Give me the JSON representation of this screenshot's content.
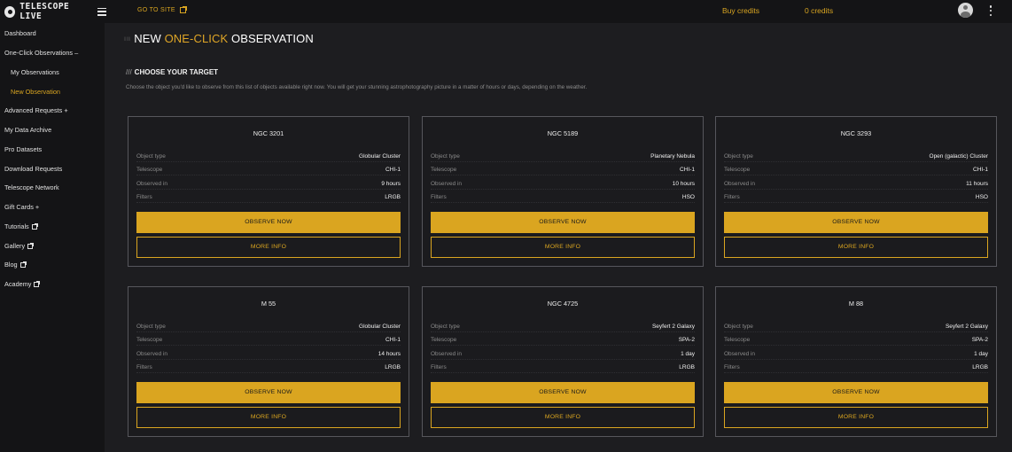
{
  "brand": {
    "name": "TELESCOPE LIVE"
  },
  "header": {
    "go_to_site": "GO TO SITE",
    "buy_credits": "Buy credits",
    "credits": "0 credits"
  },
  "sidebar": {
    "items": [
      {
        "label": "Dashboard"
      },
      {
        "label": "One-Click Observations –"
      },
      {
        "label": "My Observations"
      },
      {
        "label": "New Observation"
      },
      {
        "label": "Advanced Requests +"
      },
      {
        "label": "My Data Archive"
      },
      {
        "label": "Pro Datasets"
      },
      {
        "label": "Download Requests"
      },
      {
        "label": "Telescope Network"
      },
      {
        "label": "Gift Cards +"
      },
      {
        "label": "Tutorials"
      },
      {
        "label": "Gallery"
      },
      {
        "label": "Blog"
      },
      {
        "label": "Academy"
      }
    ]
  },
  "page": {
    "title_prefix": "NEW ",
    "title_accent": "ONE-CLICK",
    "title_suffix": " OBSERVATION",
    "section_slashes": "///",
    "section_title": "CHOOSE YOUR TARGET",
    "section_desc": "Choose the object you'd like to observe from this list of objects available right now. You will get your stunning astrophotography picture in a matter of hours or days, depending on the weather."
  },
  "labels": {
    "object_type": "Object type",
    "telescope": "Telescope",
    "observed_in": "Observed in",
    "filters": "Filters",
    "observe_now": "OBSERVE NOW",
    "more_info": "MORE INFO"
  },
  "cards": [
    {
      "name": "NGC 3201",
      "object_type": "Globular Cluster",
      "telescope": "CHI-1",
      "observed_in": "9 hours",
      "filters": "LRGB"
    },
    {
      "name": "NGC 5189",
      "object_type": "Planetary Nebula",
      "telescope": "CHI-1",
      "observed_in": "10 hours",
      "filters": "HSO"
    },
    {
      "name": "NGC 3293",
      "object_type": "Open (galactic) Cluster",
      "telescope": "CHI-1",
      "observed_in": "11 hours",
      "filters": "HSO"
    },
    {
      "name": "M 55",
      "object_type": "Globular Cluster",
      "telescope": "CHI-1",
      "observed_in": "14 hours",
      "filters": "LRGB"
    },
    {
      "name": "NGC 4725",
      "object_type": "Seyfert 2 Galaxy",
      "telescope": "SPA-2",
      "observed_in": "1 day",
      "filters": "LRGB"
    },
    {
      "name": "M 88",
      "object_type": "Seyfert 2 Galaxy",
      "telescope": "SPA-2",
      "observed_in": "1 day",
      "filters": "LRGB"
    }
  ],
  "colors": {
    "accent": "#daa520",
    "background": "#1d1d20",
    "sidebar": "#141416"
  }
}
